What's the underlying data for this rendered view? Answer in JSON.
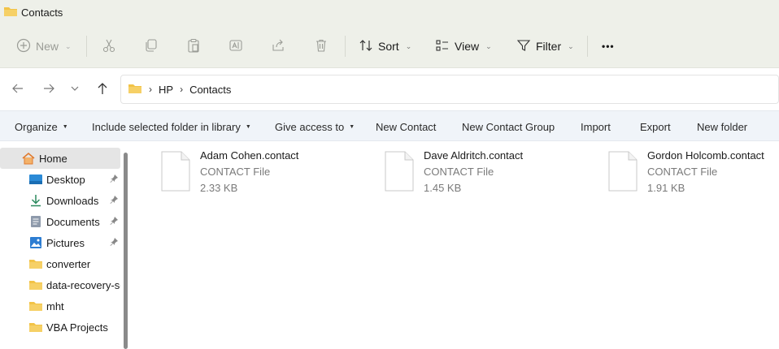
{
  "window": {
    "title": "Contacts"
  },
  "commandbar": {
    "new_label": "New",
    "sort_label": "Sort",
    "view_label": "View",
    "filter_label": "Filter",
    "more_label": "•••"
  },
  "address": {
    "breadcrumbs": [
      "HP",
      "Contacts"
    ]
  },
  "library_bar": {
    "items": [
      "Organize",
      "Include selected folder in library",
      "Give access to",
      "New Contact",
      "New Contact Group",
      "Import",
      "Export",
      "New folder"
    ]
  },
  "sidebar": {
    "items": [
      {
        "label": "Home",
        "icon": "home-icon"
      },
      {
        "label": "Desktop",
        "icon": "desktop-icon",
        "pinned": true
      },
      {
        "label": "Downloads",
        "icon": "download-icon",
        "pinned": true
      },
      {
        "label": "Documents",
        "icon": "document-icon",
        "pinned": true
      },
      {
        "label": "Pictures",
        "icon": "pictures-icon",
        "pinned": true
      },
      {
        "label": "converter",
        "icon": "folder-icon"
      },
      {
        "label": "data-recovery-sc",
        "icon": "folder-icon"
      },
      {
        "label": "mht",
        "icon": "folder-icon"
      },
      {
        "label": "VBA Projects",
        "icon": "folder-icon"
      }
    ]
  },
  "files": [
    {
      "name": "Adam Cohen.contact",
      "type": "CONTACT File",
      "size": "2.33 KB"
    },
    {
      "name": "Dave Aldritch.contact",
      "type": "CONTACT File",
      "size": "1.45 KB"
    },
    {
      "name": "Gordon Holcomb.contact",
      "type": "CONTACT File",
      "size": "1.91 KB"
    }
  ],
  "colors": {
    "folder": "#f2c347",
    "accent": "#0067c0"
  }
}
